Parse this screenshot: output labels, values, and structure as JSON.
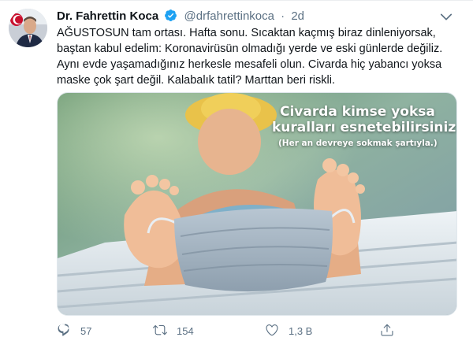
{
  "tweet": {
    "author_name": "Dr. Fahrettin Koca",
    "handle": "@drfahrettinkoca",
    "separator": "·",
    "time": "2d",
    "text": "AĞUSTOSUN tam ortası. Hafta sonu. Sıcaktan kaçmış biraz dinleniyorsak,\nbaştan kabul edelim: Koronavirüsün olmadığı yerde ve eski günlerde değiliz.\nAynı evde yaşamadığınız herkesle mesafeli olun. Civarda hiç yabancı yoksa\nmaske çok şart değil. Kalabalık tatil? Marttan beri riskli.",
    "image_text": {
      "line1": "Civarda kimse yoksa",
      "line2": "kuralları esnetebilirsiniz.",
      "line3": "(Her an devreye sokmak şartıyla.)"
    },
    "actions": {
      "replies": "57",
      "retweets": "154",
      "likes": "1,3 B"
    },
    "icons": {
      "verified": "verified-badge-icon",
      "more": "chevron-down-icon",
      "reply": "reply-icon",
      "retweet": "retweet-icon",
      "like": "heart-icon",
      "share": "share-icon"
    },
    "colors": {
      "verified": "#1da1f2",
      "meta_gray": "#5b7083",
      "text": "#0f1419"
    }
  }
}
